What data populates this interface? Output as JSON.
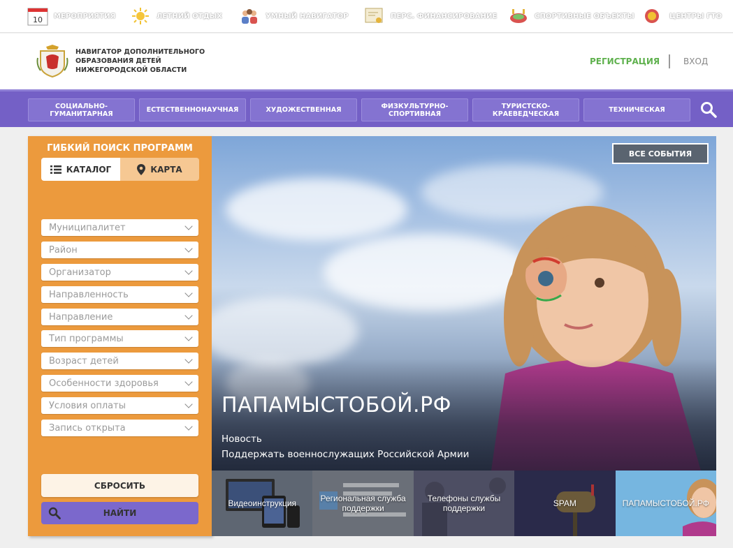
{
  "topbar": {
    "items": [
      {
        "label": "Мероприятия",
        "icon": "calendar-icon",
        "day": "10"
      },
      {
        "label": "Летний отдых",
        "icon": "sun-icon"
      },
      {
        "label": "Умный навигатор",
        "icon": "people-icon"
      },
      {
        "label": "Перс. финансирование",
        "icon": "certificate-icon"
      },
      {
        "label": "Спортивные объекты",
        "icon": "stadium-icon"
      },
      {
        "label": "Центры ГТО",
        "icon": "gto-badge-icon"
      }
    ]
  },
  "header": {
    "logo_line1": "Навигатор дополнительного",
    "logo_line2": "образования детей",
    "logo_line3": "Нижегородской области",
    "register": "Регистрация",
    "login": "Вход"
  },
  "nav": {
    "items": [
      {
        "line1": "Социально-",
        "line2": "гуманитарная"
      },
      {
        "line1": "Естественнонаучная",
        "line2": ""
      },
      {
        "line1": "Художественная",
        "line2": ""
      },
      {
        "line1": "Физкультурно-",
        "line2": "спортивная"
      },
      {
        "line1": "Туристско-",
        "line2": "краеведческая"
      },
      {
        "line1": "Техническая",
        "line2": ""
      }
    ]
  },
  "sidebar": {
    "title": "Гибкий поиск программ",
    "tab_catalog": "Каталог",
    "tab_map": "Карта",
    "filters": [
      "Муниципалитет",
      "Район",
      "Организатор",
      "Направленность",
      "Направление",
      "Тип программы",
      "Возраст детей",
      "Особенности здоровья",
      "Условия оплаты",
      "Запись открыта"
    ],
    "reset": "Сбросить",
    "find": "Найти"
  },
  "banner": {
    "all_events": "Все события",
    "title": "ПАПАМЫСТОБОЙ.РФ",
    "kind": "Новость",
    "text": "Поддержать военнослужащих Российской Армии"
  },
  "tiles": [
    {
      "line1": "Видеоинструкция",
      "line2": ""
    },
    {
      "line1": "Региональная служба",
      "line2": "поддержки"
    },
    {
      "line1": "Телефоны службы",
      "line2": "поддержки"
    },
    {
      "line1": "SPAM",
      "line2": ""
    },
    {
      "line1": "ПАПАМЫСТОБОЙ.РФ",
      "line2": ""
    }
  ],
  "colors": {
    "nav_bg": "#7460c6",
    "sidebar_bg": "#ec9a3d",
    "register_green": "#5fb14e"
  }
}
